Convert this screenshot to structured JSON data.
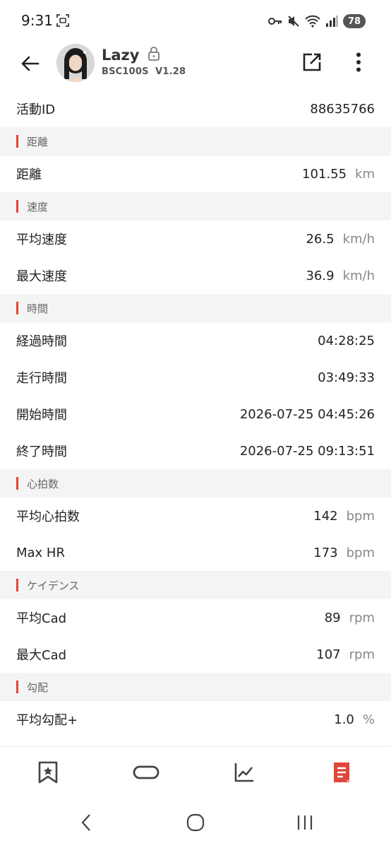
{
  "status_bar": {
    "time": "9:31",
    "battery": "78"
  },
  "app_bar": {
    "title": "Lazy",
    "subtitle": "BSC100S  V1.28"
  },
  "activity": {
    "label": "活動ID",
    "value": "88635766"
  },
  "sections": [
    {
      "title": "距離",
      "rows": [
        {
          "label": "距離",
          "value": "101.55",
          "unit": "km"
        }
      ]
    },
    {
      "title": "速度",
      "rows": [
        {
          "label": "平均速度",
          "value": "26.5",
          "unit": "km/h"
        },
        {
          "label": "最大速度",
          "value": "36.9",
          "unit": "km/h"
        }
      ]
    },
    {
      "title": "時間",
      "rows": [
        {
          "label": "経過時間",
          "value": "04:28:25",
          "unit": ""
        },
        {
          "label": "走行時間",
          "value": "03:49:33",
          "unit": ""
        },
        {
          "label": "開始時間",
          "value": "2026-07-25 04:45:26",
          "unit": ""
        },
        {
          "label": "終了時間",
          "value": "2026-07-25 09:13:51",
          "unit": ""
        }
      ]
    },
    {
      "title": "心拍数",
      "rows": [
        {
          "label": "平均心拍数",
          "value": "142",
          "unit": "bpm"
        },
        {
          "label": "Max HR",
          "value": "173",
          "unit": "bpm"
        }
      ]
    },
    {
      "title": "ケイデンス",
      "rows": [
        {
          "label": "平均Cad",
          "value": "89",
          "unit": "rpm"
        },
        {
          "label": "最大Cad",
          "value": "107",
          "unit": "rpm"
        }
      ]
    },
    {
      "title": "勾配",
      "rows": [
        {
          "label": "平均勾配+",
          "value": "1.0",
          "unit": "%"
        }
      ]
    }
  ],
  "bottom_nav": {
    "items": [
      {
        "icon": "bookmark-star-icon"
      },
      {
        "icon": "track-loop-icon"
      },
      {
        "icon": "line-chart-icon"
      },
      {
        "icon": "document-list-icon",
        "active": true
      }
    ]
  },
  "colors": {
    "accent": "#e0463a",
    "section_background": "#f4f4f4",
    "unit_text": "#888888"
  }
}
